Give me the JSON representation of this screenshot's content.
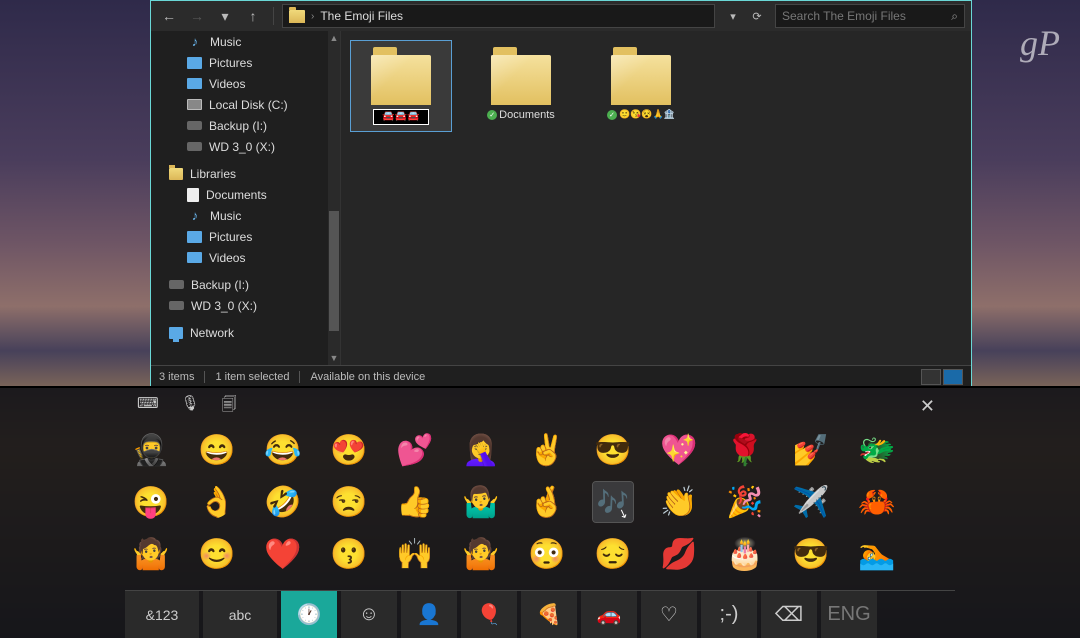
{
  "watermark": "gP",
  "explorer": {
    "nav": {
      "back": "←",
      "forward": "→",
      "recent": "▾",
      "up": "↑"
    },
    "addr": {
      "folder_name": "The Emoji Files",
      "dropdown": "▾",
      "refresh": "⟳"
    },
    "search": {
      "placeholder": "Search The Emoji Files",
      "icon": "🔍"
    },
    "sidebar": {
      "items": [
        {
          "icon": "ico-music",
          "label": "Music",
          "sub": true
        },
        {
          "icon": "ico-pic",
          "label": "Pictures",
          "sub": true
        },
        {
          "icon": "ico-vid",
          "label": "Videos",
          "sub": true
        },
        {
          "icon": "ico-disk",
          "label": "Local Disk (C:)",
          "sub": true
        },
        {
          "icon": "ico-drv",
          "label": "Backup (I:)",
          "sub": true
        },
        {
          "icon": "ico-drv",
          "label": "WD 3_0 (X:)",
          "sub": true
        }
      ],
      "libraries_label": "Libraries",
      "libs": [
        {
          "icon": "ico-doc",
          "label": "Documents"
        },
        {
          "icon": "ico-music",
          "label": "Music"
        },
        {
          "icon": "ico-pic",
          "label": "Pictures"
        },
        {
          "icon": "ico-vid",
          "label": "Videos"
        }
      ],
      "drives": [
        {
          "icon": "ico-drv",
          "label": "Backup (I:)"
        },
        {
          "icon": "ico-drv",
          "label": "WD 3_0 (X:)"
        }
      ],
      "network": {
        "icon": "ico-net",
        "label": "Network"
      }
    },
    "content": {
      "items": [
        {
          "rename": true,
          "value": "🚘🚘🚘"
        },
        {
          "sync": true,
          "label": "Documents"
        },
        {
          "sync": true,
          "label": "🙂😘😵🙏🏦"
        }
      ]
    },
    "status": {
      "count": "3 items",
      "selected": "1 item selected",
      "avail": "Available on this device"
    }
  },
  "osk": {
    "tools": {
      "keyboard": "⌨",
      "mic": "🎤",
      "clipboard": "📋"
    },
    "close": "✕",
    "emoji_rows": [
      [
        "ninja",
        "grin",
        "joy",
        "heart-eyes",
        "two-hearts",
        "facepalm",
        "victory",
        "sunglasses",
        "sparkle-heart",
        "rose",
        "nail",
        "dragon"
      ],
      [
        "tongue",
        "ok-hand",
        "rofl",
        "unamused",
        "thumbs-up",
        "shrug-m",
        "crossed",
        "music",
        "clap",
        "party",
        "airplane",
        "crab"
      ],
      [
        "shrug",
        "smile",
        "heart",
        "kiss-face",
        "praise",
        "shrug-n",
        "flushed",
        "pensive",
        "kiss",
        "cake",
        "cool-cat",
        "swim-cat"
      ]
    ],
    "highlighted": "music",
    "bottom": [
      {
        "id": "sym",
        "label": "&123"
      },
      {
        "id": "abc",
        "label": "abc"
      },
      {
        "id": "recent",
        "label": "🕐",
        "active": true
      },
      {
        "id": "smileys",
        "label": "☺"
      },
      {
        "id": "people",
        "label": "👤"
      },
      {
        "id": "celebrate",
        "label": "🎈"
      },
      {
        "id": "food",
        "label": "🍕"
      },
      {
        "id": "transport",
        "label": "🚗"
      },
      {
        "id": "hearts",
        "label": "♡"
      },
      {
        "id": "ascii",
        "label": ";-)"
      },
      {
        "id": "back",
        "label": "⌫"
      },
      {
        "id": "lang",
        "label": "ENG"
      }
    ]
  }
}
